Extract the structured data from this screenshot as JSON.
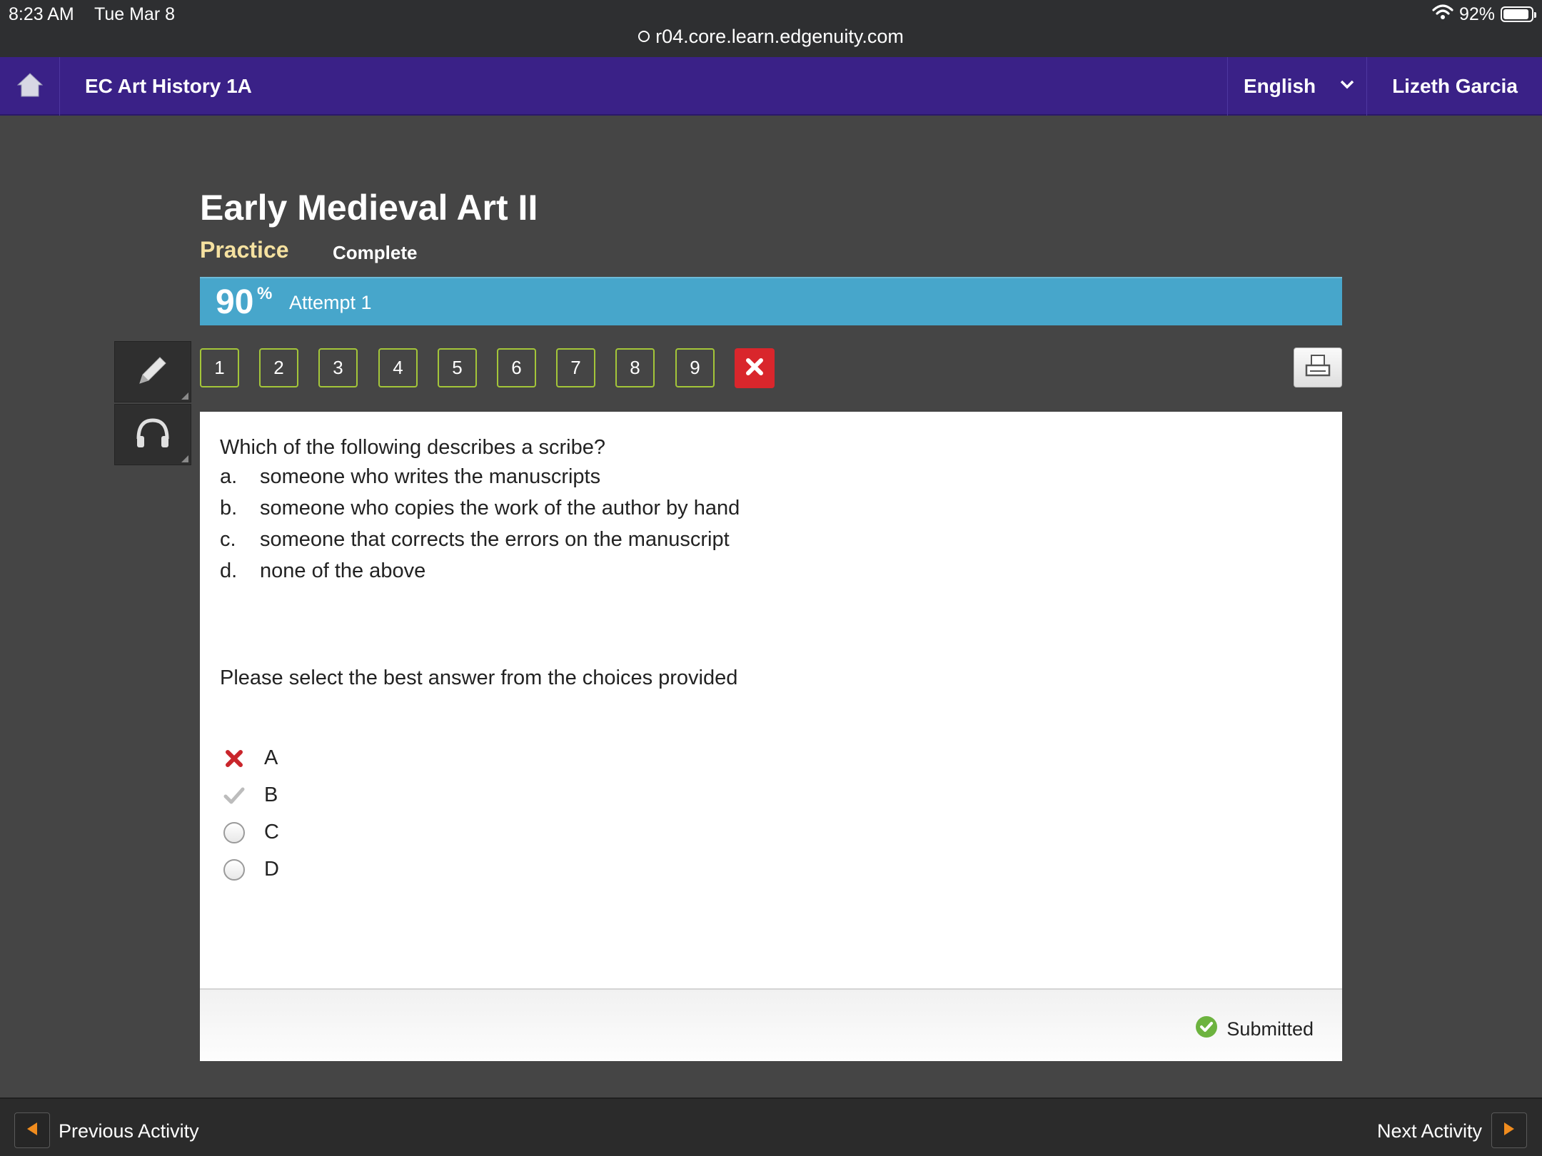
{
  "status_bar": {
    "time": "8:23 AM",
    "date": "Tue Mar 8",
    "battery": "92%",
    "battery_level": 0.92
  },
  "browser": {
    "url": "r04.core.learn.edgenuity.com"
  },
  "header": {
    "course_title": "EC Art History 1A",
    "language": "English",
    "user_name": "Lizeth Garcia"
  },
  "lesson": {
    "title": "Early Medieval Art II",
    "activity_type": "Practice",
    "status": "Complete"
  },
  "score": {
    "value": "90",
    "unit": "%",
    "attempt": "Attempt 1"
  },
  "question_nav": {
    "numbers": [
      "1",
      "2",
      "3",
      "4",
      "5",
      "6",
      "7",
      "8",
      "9"
    ],
    "colors": {
      "border": "#a4c639",
      "incorrect": "#d9262c"
    }
  },
  "question": {
    "text": "Which of the following describes a scribe?",
    "choices": [
      {
        "letter": "a.",
        "text": "someone who writes the manuscripts"
      },
      {
        "letter": "b.",
        "text": "someone who copies the work of the author by hand"
      },
      {
        "letter": "c.",
        "text": "someone that corrects the errors on the manuscript"
      },
      {
        "letter": "d.",
        "text": "none of the above"
      }
    ],
    "instruction": "Please select the best answer from the choices provided"
  },
  "answers": [
    {
      "label": "A",
      "state": "incorrect"
    },
    {
      "label": "B",
      "state": "correct"
    },
    {
      "label": "C",
      "state": "unselected"
    },
    {
      "label": "D",
      "state": "unselected"
    }
  ],
  "footer": {
    "submission_status": "Submitted"
  },
  "bottom_nav": {
    "previous": "Previous Activity",
    "next": "Next Activity"
  },
  "colors": {
    "header_bg": "#3a2187",
    "score_bar": "#47a6cb",
    "practice": "#f5e1a0",
    "success": "#6db33f"
  }
}
